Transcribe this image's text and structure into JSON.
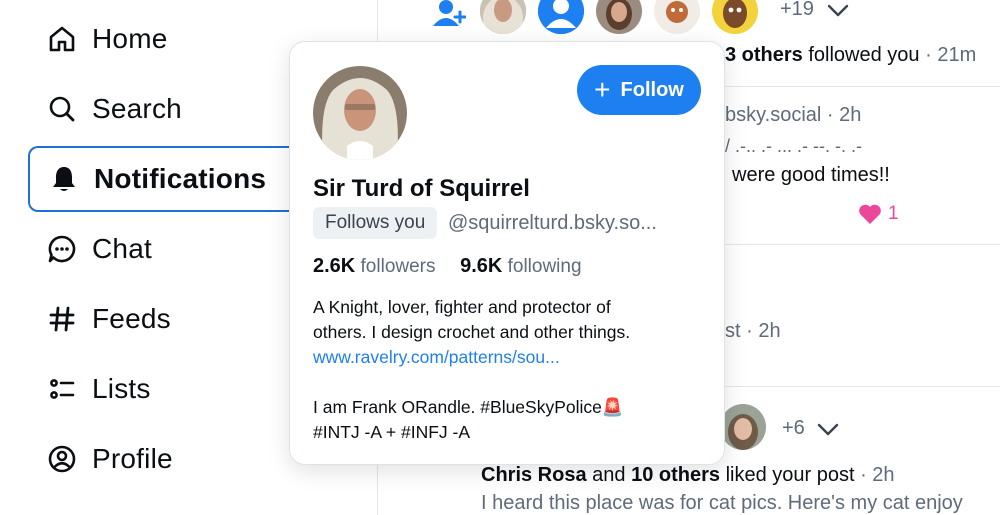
{
  "sidebar": {
    "items": [
      {
        "label": "Home",
        "icon": "home-icon"
      },
      {
        "label": "Search",
        "icon": "search-icon"
      },
      {
        "label": "Notifications",
        "icon": "bell-icon",
        "active": true
      },
      {
        "label": "Chat",
        "icon": "chat-icon"
      },
      {
        "label": "Feeds",
        "icon": "hash-icon"
      },
      {
        "label": "Lists",
        "icon": "list-icon"
      },
      {
        "label": "Profile",
        "icon": "profile-icon"
      }
    ]
  },
  "feed": {
    "follow_group": {
      "more_count": "+19",
      "text_bold": "3 others",
      "text_rest": " followed you",
      "time": " · 21m"
    },
    "post1": {
      "handle": "bsky.social",
      "time": " · 2h",
      "ascii": "/ .-.. .- ... .- --. -. .-",
      "text": "were good times!!",
      "like_count": "1"
    },
    "post2": {
      "partial": "st",
      "time": " · 2h"
    },
    "like_group": {
      "more_count": "+6",
      "name": "Chris Rosa",
      "and": " and ",
      "others": "10 others",
      "action": " liked your post",
      "time": " · 2h",
      "snippet": "I heard this place was for cat pics. Here's my cat enjoy"
    }
  },
  "card": {
    "follow_label": "Follow",
    "name": "Sir Turd of Squirrel",
    "follows_you": "Follows you",
    "handle": "@squirrelturd.bsky.so...",
    "followers_count": "2.6K",
    "followers_label": "followers",
    "following_count": "9.6K",
    "following_label": "following",
    "bio_line1": "A Knight, lover, fighter and protector of",
    "bio_line2": "others. I design crochet and other things.",
    "bio_link": "www.ravelry.com/patterns/sou...",
    "bio_line3": "I am Frank ORandle. #BlueSkyPolice🚨",
    "bio_line4": "#INTJ -A + #INFJ -A"
  },
  "colors": {
    "accent": "#1e80f0",
    "active_border": "#1f6fd9",
    "heart": "#ec4899"
  }
}
